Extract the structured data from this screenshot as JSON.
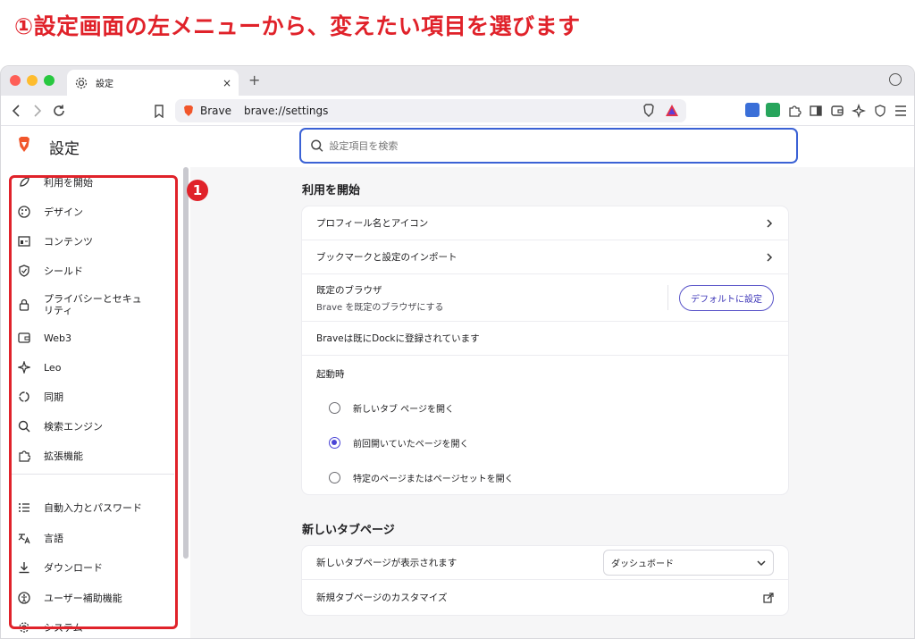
{
  "caption": "①設定画面の左メニューから、変えたい項目を選びます",
  "tab": {
    "title": "設定",
    "close": "×",
    "new": "+"
  },
  "urlbar": {
    "brand": "Brave",
    "url": "brave://settings"
  },
  "page": {
    "title": "設定",
    "search_placeholder": "設定項目を検索"
  },
  "badge": "1",
  "sidebar": {
    "items": [
      {
        "label": "利用を開始",
        "icon": "rocket-icon"
      },
      {
        "label": "デザイン",
        "icon": "palette-icon"
      },
      {
        "label": "コンテンツ",
        "icon": "content-icon"
      },
      {
        "label": "シールド",
        "icon": "shield-icon"
      },
      {
        "label": "プライバシーとセキュリティ",
        "icon": "lock-icon"
      },
      {
        "label": "Web3",
        "icon": "wallet-icon"
      },
      {
        "label": "Leo",
        "icon": "sparkle-icon"
      },
      {
        "label": "同期",
        "icon": "sync-icon"
      },
      {
        "label": "検索エンジン",
        "icon": "search-icon"
      },
      {
        "label": "拡張機能",
        "icon": "puzzle-icon"
      },
      {
        "label": "自動入力とパスワード",
        "icon": "list-icon"
      },
      {
        "label": "言語",
        "icon": "translate-icon"
      },
      {
        "label": "ダウンロード",
        "icon": "download-icon"
      },
      {
        "label": "ユーザー補助機能",
        "icon": "accessibility-icon"
      },
      {
        "label": "システム",
        "icon": "gear-icon"
      }
    ]
  },
  "main": {
    "getting_started": {
      "title": "利用を開始",
      "profile": "プロフィール名とアイコン",
      "import": "ブックマークと設定のインポート",
      "default_browser_title": "既定のブラウザ",
      "default_browser_desc": "Brave を既定のブラウザにする",
      "default_button": "デフォルトに設定",
      "dock": "Braveは既にDockに登録されています",
      "startup_title": "起動時",
      "startup_options": [
        {
          "label": "新しいタブ ページを開く",
          "selected": false
        },
        {
          "label": "前回開いていたページを開く",
          "selected": true
        },
        {
          "label": "特定のページまたはページセットを開く",
          "selected": false
        }
      ]
    },
    "new_tab": {
      "title": "新しいタブページ",
      "shows_label": "新しいタブページが表示されます",
      "shows_value": "ダッシュボード",
      "customize": "新規タブページのカスタマイズ"
    }
  },
  "colors": {
    "accent": "#3b62d5",
    "annotation": "#e0222a",
    "radio": "#4b45d6"
  }
}
